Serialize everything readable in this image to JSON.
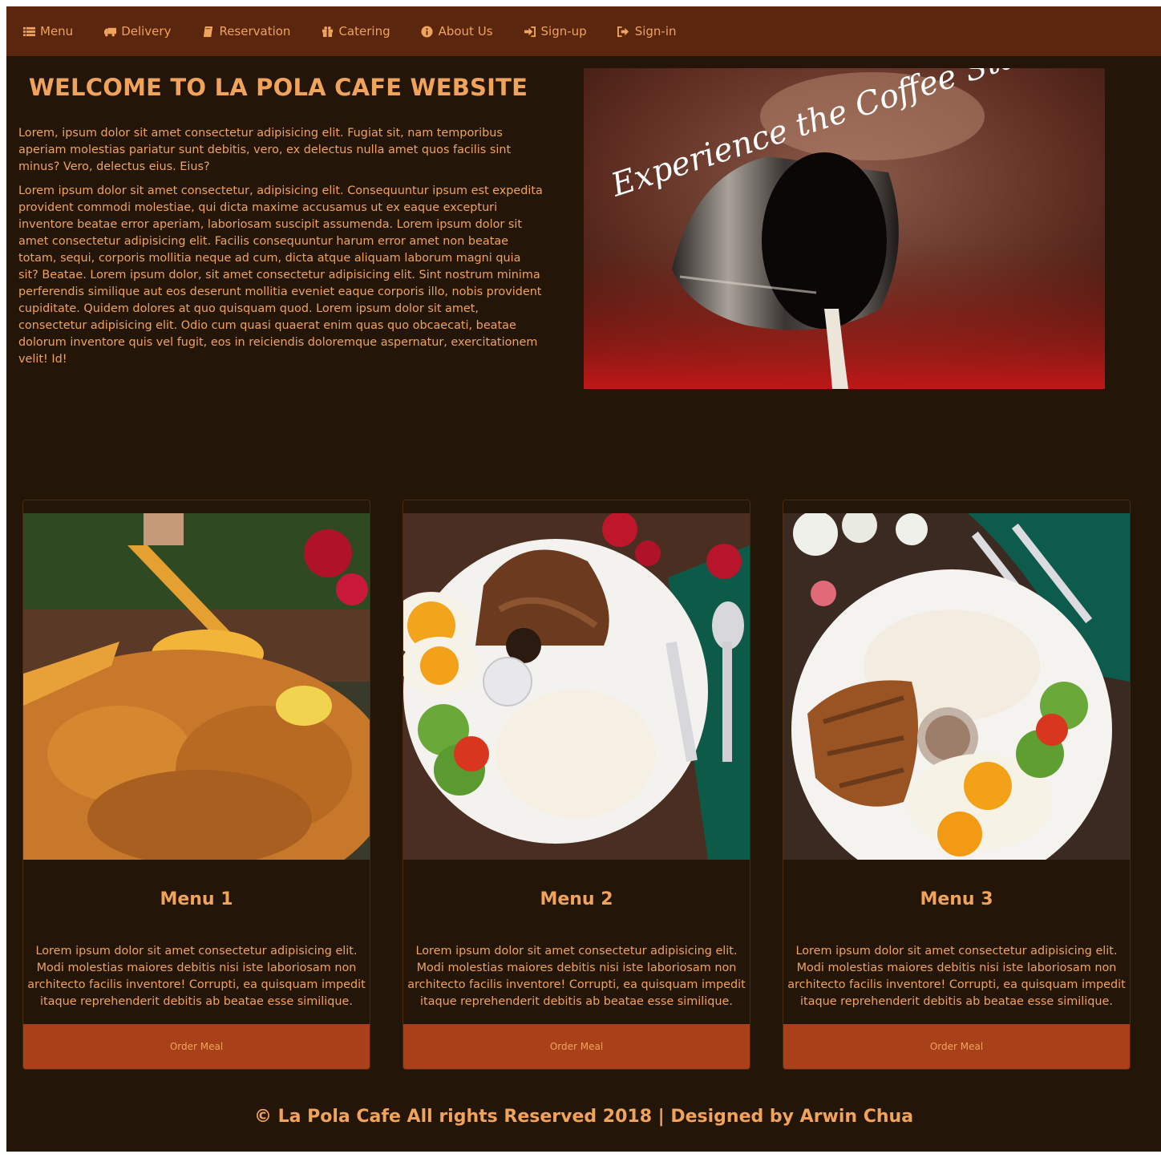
{
  "nav": {
    "items": [
      {
        "label": "Menu",
        "icon": "list-icon"
      },
      {
        "label": "Delivery",
        "icon": "truck-icon"
      },
      {
        "label": "Reservation",
        "icon": "book-icon"
      },
      {
        "label": "Catering",
        "icon": "gift-icon"
      },
      {
        "label": "About Us",
        "icon": "info-icon"
      },
      {
        "label": "Sign-up",
        "icon": "sign-up-icon"
      },
      {
        "label": "Sign-in",
        "icon": "sign-in-icon"
      }
    ]
  },
  "hero": {
    "heading": "WELCOME TO LA POLA CAFE WEBSITE",
    "paragraphs": [
      "Lorem, ipsum dolor sit amet consectetur adipisicing elit. Fugiat sit, nam temporibus aperiam molestias pariatur sunt debitis, vero, ex delectus nulla amet quos facilis sint minus? Vero, delectus eius. Eius?",
      "Lorem ipsum dolor sit amet consectetur, adipisicing elit. Consequuntur ipsum est expedita provident commodi molestiae, qui dicta maxime accusamus ut ex eaque excepturi inventore beatae error aperiam, laboriosam suscipit assumenda. Lorem ipsum dolor sit amet consectetur adipisicing elit. Facilis consequuntur harum error amet non beatae totam, sequi, corporis mollitia neque ad cum, dicta atque aliquam laborum magni quia sit? Beatae. Lorem ipsum dolor, sit amet consectetur adipisicing elit. Sint nostrum minima perferendis similique aut eos deserunt mollitia eveniet eaque corporis illo, nobis provident cupiditate. Quidem dolores at quo quisquam quod. Lorem ipsum dolor sit amet, consectetur adipisicing elit. Odio cum quasi quaerat enim quas quo obcaecati, beatae dolorum inventore quis vel fugit, eos in reiciendis doloremque aspernatur, exercitationem velit! Id!"
    ],
    "image_caption": "Experience the Coffee Standard"
  },
  "cards": [
    {
      "title": "Menu 1",
      "description": "Lorem ipsum dolor sit amet consectetur adipisicing elit. Modi molestias maiores debitis nisi iste laboriosam non architecto facilis inventore! Corrupti, ea quisquam impedit itaque reprehenderit debitis ab beatae esse similique.",
      "button": "Order Meal"
    },
    {
      "title": "Menu 2",
      "description": "Lorem ipsum dolor sit amet consectetur adipisicing elit. Modi molestias maiores debitis nisi iste laboriosam non architecto facilis inventore! Corrupti, ea quisquam impedit itaque reprehenderit debitis ab beatae esse similique.",
      "button": "Order Meal"
    },
    {
      "title": "Menu 3",
      "description": "Lorem ipsum dolor sit amet consectetur adipisicing elit. Modi molestias maiores debitis nisi iste laboriosam non architecto facilis inventore! Corrupti, ea quisquam impedit itaque reprehenderit debitis ab beatae esse similique.",
      "button": "Order Meal"
    }
  ],
  "footer": {
    "text": "© La Pola Cafe All rights Reserved 2018 | Designed by Arwin Chua"
  },
  "colors": {
    "page_bg": "#231507",
    "navbar_bg": "#5a260d",
    "accent_text": "#f0a35c",
    "button_bg": "#a8411a"
  }
}
